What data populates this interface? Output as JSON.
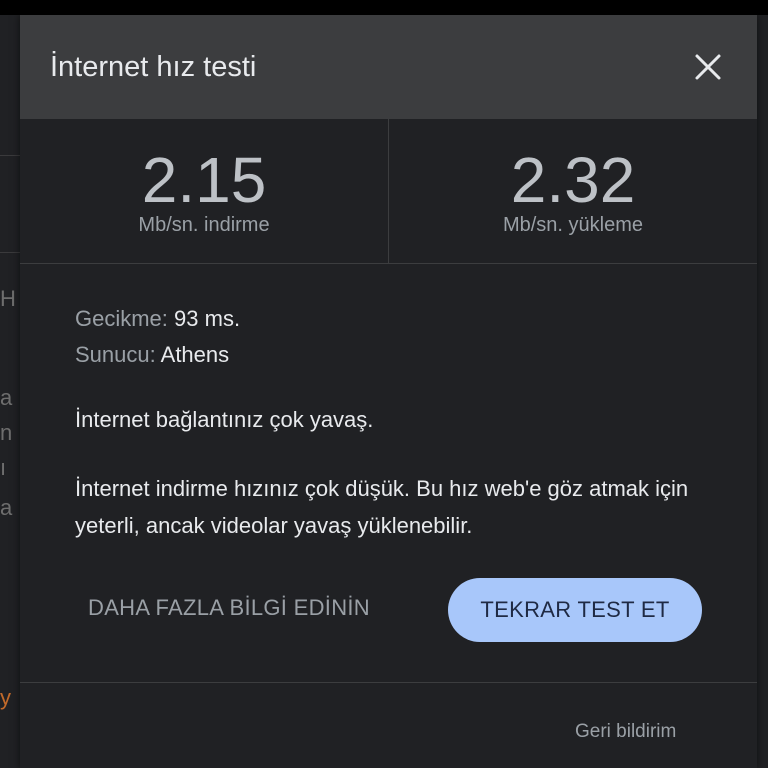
{
  "dialog": {
    "title": "İnternet hız testi",
    "close_icon": "close-icon",
    "download": {
      "value": "2.15",
      "unit": "Mb/sn. indirme"
    },
    "upload": {
      "value": "2.32",
      "unit": "Mb/sn. yükleme"
    },
    "latency": {
      "label": "Gecikme:",
      "value": "93 ms."
    },
    "server": {
      "label": "Sunucu:",
      "value": "Athens"
    },
    "status_message": "İnternet bağlantınız çok yavaş.",
    "detail_message": "İnternet indirme hızınız çok düşük. Bu hız web'e göz atmak için yeterli, ancak videolar yavaş yüklenebilir.",
    "more_info_label": "DAHA FAZLA BİLGİ EDİNİN",
    "retest_label": "TEKRAR TEST ET",
    "feedback_label": "Geri bildirim"
  },
  "colors": {
    "header_bg": "#3c3d3f",
    "dialog_bg": "#202124",
    "accent_button": "#a8c7fa"
  }
}
